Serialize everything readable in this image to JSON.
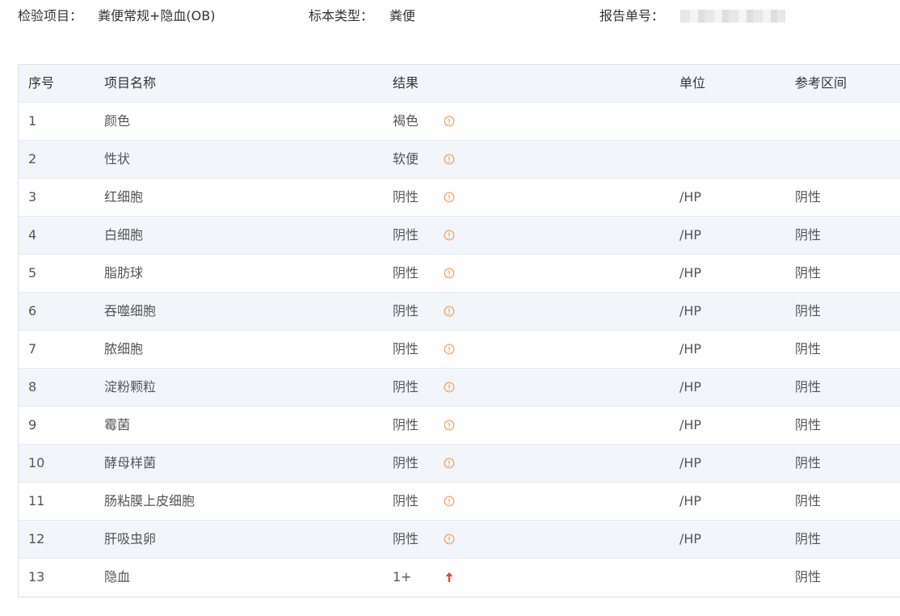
{
  "header": {
    "project_label": "检验项目：",
    "project_value": "粪便常规+隐血(OB)",
    "sample_label": "标本类型：",
    "sample_value": "粪便",
    "report_label": "报告单号："
  },
  "table": {
    "columns": {
      "index": "序号",
      "name": "项目名称",
      "result": "结果",
      "unit": "单位",
      "reference": "参考区间"
    },
    "rows": [
      {
        "index": "1",
        "name": "颜色",
        "result": "褐色",
        "flag": "info-icon",
        "unit": "",
        "reference": ""
      },
      {
        "index": "2",
        "name": "性状",
        "result": "软便",
        "flag": "info-icon",
        "unit": "",
        "reference": ""
      },
      {
        "index": "3",
        "name": "红细胞",
        "result": "阴性",
        "flag": "info-icon",
        "unit": "/HP",
        "reference": "阴性"
      },
      {
        "index": "4",
        "name": "白细胞",
        "result": "阴性",
        "flag": "info-icon",
        "unit": "/HP",
        "reference": "阴性"
      },
      {
        "index": "5",
        "name": "脂肪球",
        "result": "阴性",
        "flag": "info-icon",
        "unit": "/HP",
        "reference": "阴性"
      },
      {
        "index": "6",
        "name": "吞噬细胞",
        "result": "阴性",
        "flag": "info-icon",
        "unit": "/HP",
        "reference": "阴性"
      },
      {
        "index": "7",
        "name": "脓细胞",
        "result": "阴性",
        "flag": "info-icon",
        "unit": "/HP",
        "reference": "阴性"
      },
      {
        "index": "8",
        "name": "淀粉颗粒",
        "result": "阴性",
        "flag": "info-icon",
        "unit": "/HP",
        "reference": "阴性"
      },
      {
        "index": "9",
        "name": "霉菌",
        "result": "阴性",
        "flag": "info-icon",
        "unit": "/HP",
        "reference": "阴性"
      },
      {
        "index": "10",
        "name": "酵母样菌",
        "result": "阴性",
        "flag": "info-icon",
        "unit": "/HP",
        "reference": "阴性"
      },
      {
        "index": "11",
        "name": "肠粘膜上皮细胞",
        "result": "阴性",
        "flag": "info-icon",
        "unit": "/HP",
        "reference": "阴性"
      },
      {
        "index": "12",
        "name": "肝吸虫卵",
        "result": "阴性",
        "flag": "info-icon",
        "unit": "/HP",
        "reference": "阴性"
      },
      {
        "index": "13",
        "name": "隐血",
        "result": "1+",
        "flag": "arrow-up-icon",
        "unit": "",
        "reference": "阴性"
      }
    ]
  },
  "colors": {
    "link": "#2a6fa8",
    "info_flag": "#f0a05a",
    "high_flag": "#e0483c",
    "stripe": "#f2f6fa"
  }
}
